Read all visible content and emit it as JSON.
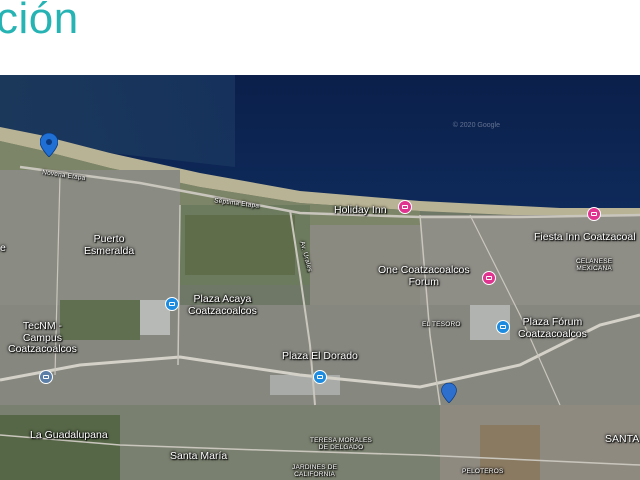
{
  "heading": "ción",
  "map": {
    "copyright": "© 2020 Google",
    "roads": [
      {
        "id": "novena",
        "label": "Novena Etapa"
      },
      {
        "id": "septima",
        "label": "Séptima Etapa"
      },
      {
        "id": "alfaro",
        "label": "Av. Urales"
      }
    ],
    "places": [
      {
        "id": "puerto-esmeralda",
        "label": "Puerto\nEsmeralda"
      },
      {
        "id": "tecnm",
        "label": "TecNM -\nCampus\nCoatzacoalcos"
      },
      {
        "id": "la-guadalupana",
        "label": "La Guadalupana"
      },
      {
        "id": "santa-maria",
        "label": "Santa María"
      },
      {
        "id": "el-tesoro",
        "label": "EL TESORO"
      },
      {
        "id": "teresa",
        "label": "TERESA MORALES\nDE DELGADO"
      },
      {
        "id": "jardines",
        "label": "JARDINES DE\nCALIFORNIA"
      },
      {
        "id": "peloteros",
        "label": "PELOTEROS"
      },
      {
        "id": "celanese",
        "label": "CELANESE\nMEXICANA"
      },
      {
        "id": "santa",
        "label": "SANTA"
      },
      {
        "id": "e-left",
        "label": "e"
      }
    ],
    "pois": [
      {
        "id": "holiday-inn",
        "label": "Holiday Inn",
        "icon": "hotel-icon",
        "color": "#e0338f"
      },
      {
        "id": "fiesta-inn",
        "label": "Fiesta Inn Coatzacoal",
        "icon": "hotel-icon",
        "color": "#e0338f"
      },
      {
        "id": "one-coatza",
        "label": "One Coatzacoalcos\nForum",
        "icon": "hotel-icon",
        "color": "#e0338f"
      },
      {
        "id": "plaza-acaya",
        "label": "Plaza Acaya\nCoatzacoalcos",
        "icon": "shopping-icon",
        "color": "#1d8ce0"
      },
      {
        "id": "plaza-eldorado",
        "label": "Plaza El Dorado",
        "icon": "shopping-icon",
        "color": "#1d8ce0"
      },
      {
        "id": "plaza-forum",
        "label": "Plaza Fórum\nCoatzacoalcos",
        "icon": "shopping-icon",
        "color": "#1d8ce0"
      },
      {
        "id": "school",
        "label": "",
        "icon": "school-icon",
        "color": "#5c7fa8"
      }
    ]
  }
}
